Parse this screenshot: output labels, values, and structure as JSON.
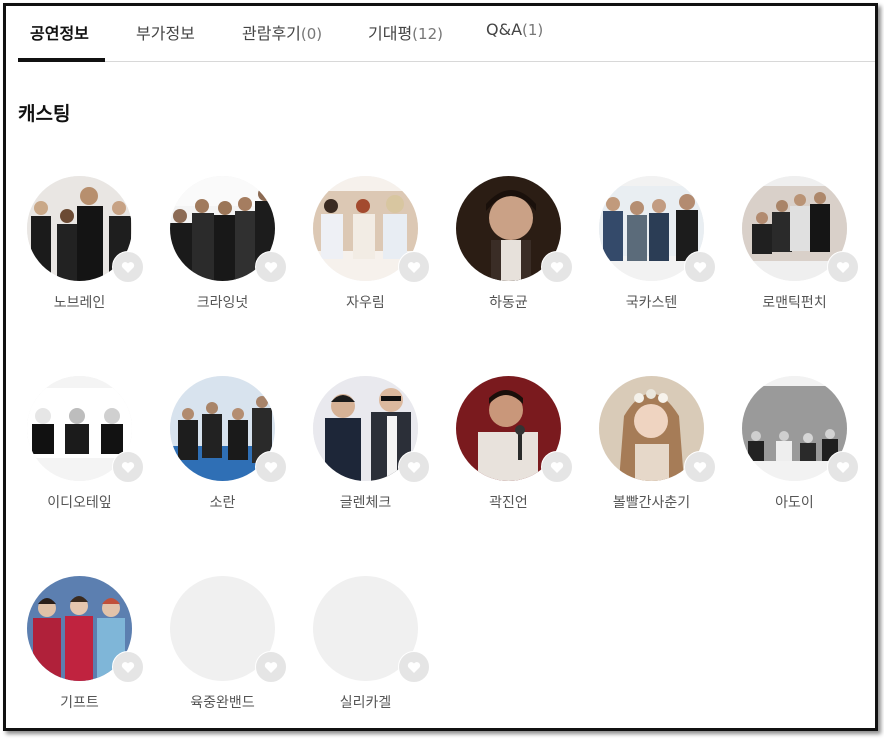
{
  "tabs": [
    {
      "label": "공연정보",
      "count": ""
    },
    {
      "label": "부가정보",
      "count": ""
    },
    {
      "label": "관람후기",
      "count": "(0)"
    },
    {
      "label": "기대평",
      "count": "(12)"
    },
    {
      "label": "Q&A",
      "count": "(1)"
    }
  ],
  "section_title": "캐스팅",
  "cast": [
    {
      "name": "노브레인",
      "photo": "group-dark-suits"
    },
    {
      "name": "크라잉넛",
      "photo": "group-black-outfits"
    },
    {
      "name": "자우림",
      "photo": "group-light-beige"
    },
    {
      "name": "하동균",
      "photo": "portrait-dark"
    },
    {
      "name": "국카스텐",
      "photo": "group-denim-jackets"
    },
    {
      "name": "로맨틱펀치",
      "photo": "group-seated-black"
    },
    {
      "name": "이디오테잎",
      "photo": "group-monochrome"
    },
    {
      "name": "소란",
      "photo": "group-blue-studio"
    },
    {
      "name": "글렌체크",
      "photo": "duo-sunglasses"
    },
    {
      "name": "곽진언",
      "photo": "singer-microphone-red"
    },
    {
      "name": "볼빨간사춘기",
      "photo": "woman-floral-crown"
    },
    {
      "name": "아도이",
      "photo": "group-grey-wall"
    },
    {
      "name": "기프트",
      "photo": "group-red-shirts"
    },
    {
      "name": "육중완밴드",
      "photo": "placeholder"
    },
    {
      "name": "실리카겔",
      "photo": "placeholder"
    }
  ],
  "icons": {
    "favorite": "heart-icon"
  },
  "colors": {
    "active_tab": "#111111",
    "heart_bg": "#e5e5e5",
    "placeholder_bg": "#f0f0f0"
  }
}
